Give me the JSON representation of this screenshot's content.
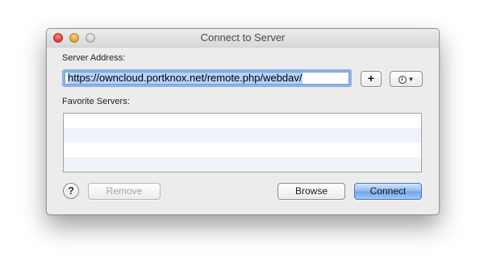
{
  "window": {
    "title": "Connect to Server"
  },
  "server_address": {
    "label": "Server Address:",
    "value": "https://owncloud.portknox.net/remote.php/webdav/"
  },
  "favorites": {
    "label": "Favorite Servers:",
    "items": []
  },
  "buttons": {
    "add_label": "+",
    "help_label": "?",
    "remove_label": "Remove",
    "browse_label": "Browse",
    "connect_label": "Connect"
  },
  "icons": {
    "close": "close-icon",
    "minimize": "minimize-icon",
    "zoom": "zoom-icon",
    "recent": "clock-icon",
    "recent_dropdown": "chevron-down-icon"
  },
  "colors": {
    "accent": "#8fb2e8",
    "default_button": "#6ea4ea",
    "row_alternate": "#eff4fb"
  }
}
